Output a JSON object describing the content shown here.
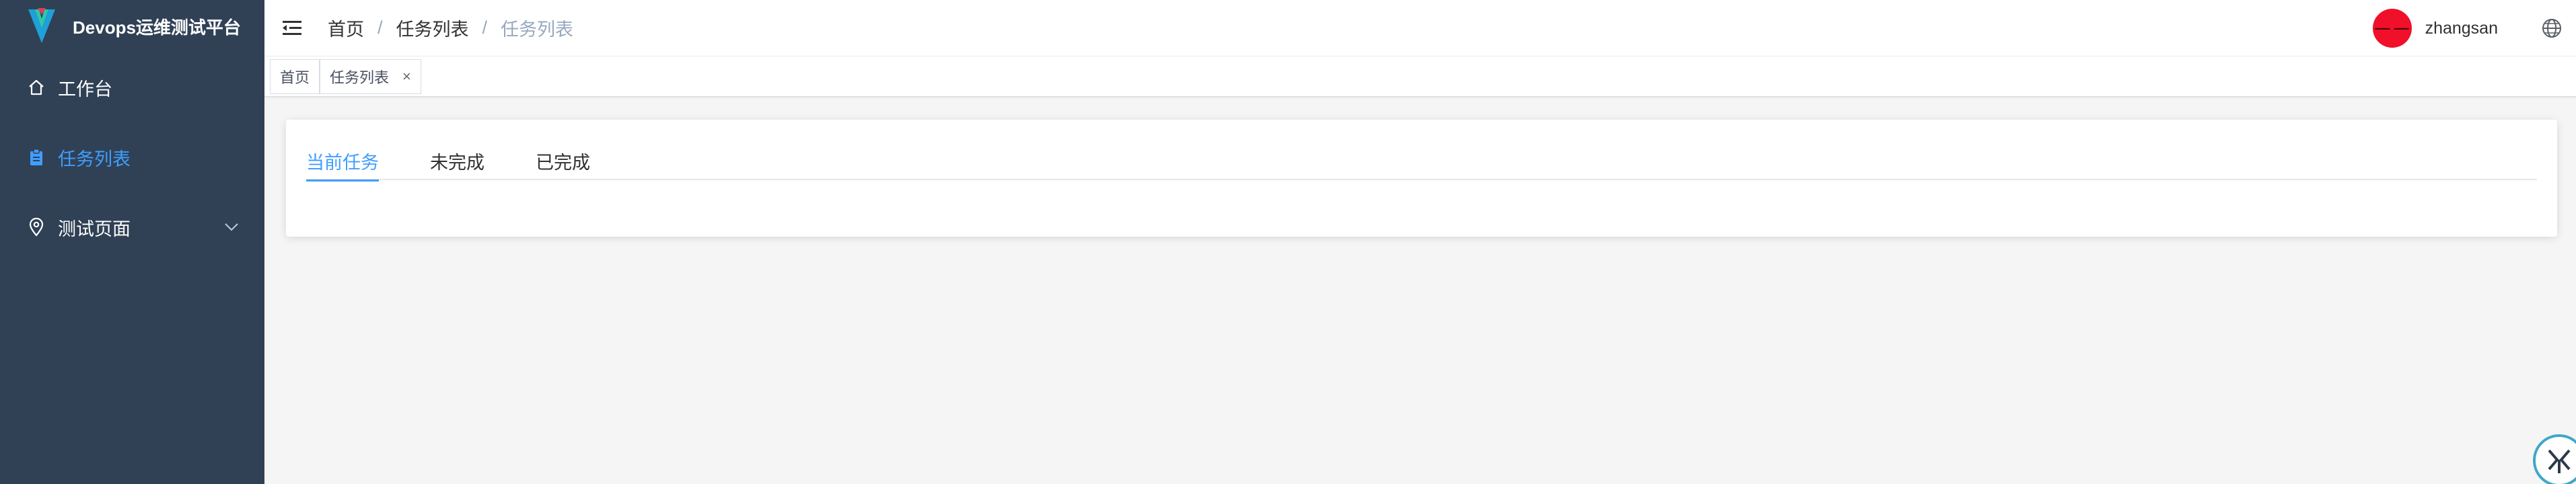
{
  "app": {
    "title": "Devops运维测试平台",
    "colors": {
      "sidebar_bg": "#304156",
      "accent": "#409eff",
      "avatar": "#f0102a"
    }
  },
  "sidebar": {
    "items": [
      {
        "label": "工作台",
        "icon": "home-icon",
        "active": false
      },
      {
        "label": "任务列表",
        "icon": "clipboard-icon",
        "active": true
      },
      {
        "label": "测试页面",
        "icon": "location-pin-icon",
        "active": false,
        "expandable": true
      }
    ]
  },
  "header": {
    "breadcrumb": [
      "首页",
      "任务列表",
      "任务列表"
    ],
    "breadcrumb_sep": "/",
    "user": {
      "avatar_text": "— —",
      "name": "zhangsan"
    }
  },
  "tags": [
    {
      "label": "首页",
      "closable": false
    },
    {
      "label": "任务列表",
      "closable": true,
      "close_glyph": "×"
    }
  ],
  "tabs": [
    {
      "label": "当前任务",
      "active": true
    },
    {
      "label": "未完成",
      "active": false
    },
    {
      "label": "已完成",
      "active": false
    }
  ]
}
